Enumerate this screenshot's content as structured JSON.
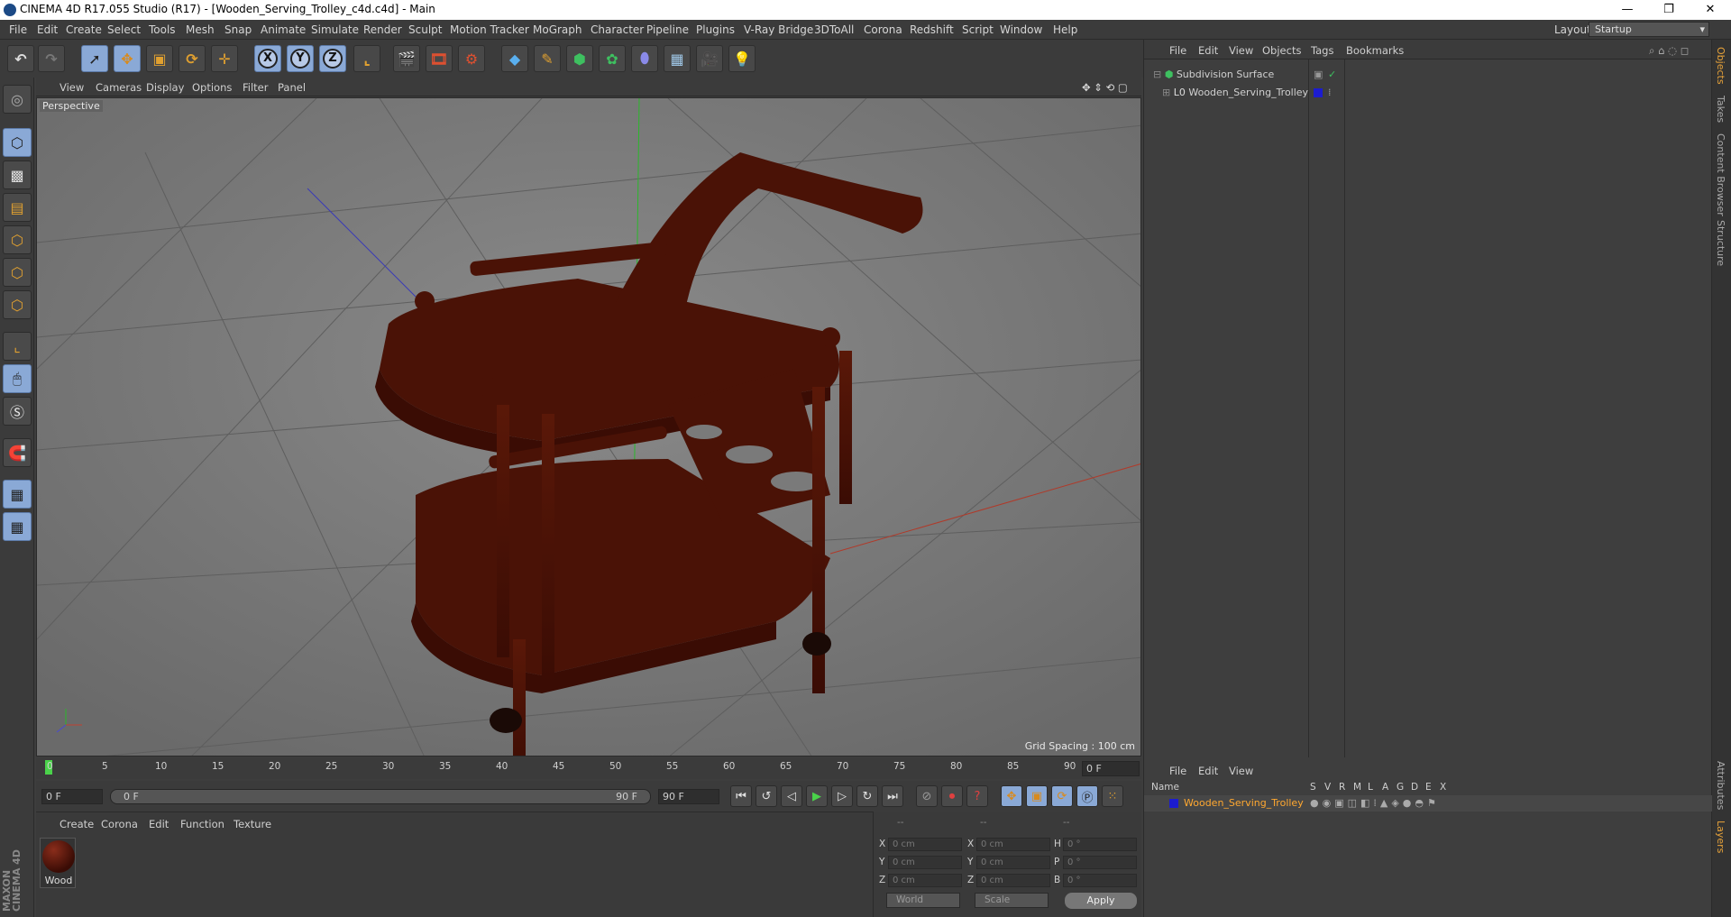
{
  "window": {
    "title": "CINEMA 4D R17.055 Studio (R17) - [Wooden_Serving_Trolley_c4d.c4d] - Main",
    "minimize": "—",
    "restore": "❐",
    "close": "✕"
  },
  "menu": {
    "items": [
      "File",
      "Edit",
      "Create",
      "Select",
      "Tools",
      "Mesh",
      "Snap",
      "Animate",
      "Simulate",
      "Render",
      "Sculpt",
      "Motion Tracker",
      "MoGraph",
      "Character",
      "Pipeline",
      "Plugins",
      "V-Ray Bridge",
      "3DToAll",
      "Corona",
      "Redshift",
      "Script",
      "Window",
      "Help"
    ],
    "layout_label": "Layout:",
    "layout_value": "Startup"
  },
  "toolbar": {
    "axis_x": "X",
    "axis_y": "Y",
    "axis_z": "Z"
  },
  "viewport": {
    "menu": [
      "View",
      "Cameras",
      "Display",
      "Options",
      "Filter",
      "Panel"
    ],
    "camera_label": "Perspective",
    "grid_spacing": "Grid Spacing : 100 cm"
  },
  "objects_panel": {
    "menu": [
      "File",
      "Edit",
      "View",
      "Objects",
      "Tags",
      "Bookmarks"
    ],
    "rows": [
      {
        "name": "Subdivision Surface"
      },
      {
        "name": "Wooden_Serving_Trolley"
      }
    ]
  },
  "side_tabs": [
    "Objects",
    "Takes",
    "Content Browser",
    "Structure"
  ],
  "side_tabs_bottom": [
    "Attributes",
    "Layers"
  ],
  "timeline": {
    "ticks": [
      "0",
      "5",
      "10",
      "15",
      "20",
      "25",
      "30",
      "35",
      "40",
      "45",
      "50",
      "55",
      "60",
      "65",
      "70",
      "75",
      "80",
      "85",
      "90"
    ],
    "current_frame": "0 F"
  },
  "transport": {
    "start_field": "0 F",
    "range_start": "0 F",
    "range_end": "90 F",
    "end_field": "90 F"
  },
  "materials": {
    "menu": [
      "Create",
      "Corona",
      "Edit",
      "Function",
      "Texture"
    ],
    "items": [
      {
        "name": "Wood"
      }
    ]
  },
  "coordinates": {
    "headers": [
      "--",
      "--",
      "--"
    ],
    "rows": [
      {
        "a_lbl": "X",
        "a_val": "0 cm",
        "b_lbl": "X",
        "b_val": "0 cm",
        "c_lbl": "H",
        "c_val": "0 °"
      },
      {
        "a_lbl": "Y",
        "a_val": "0 cm",
        "b_lbl": "Y",
        "b_val": "0 cm",
        "c_lbl": "P",
        "c_val": "0 °"
      },
      {
        "a_lbl": "Z",
        "a_val": "0 cm",
        "b_lbl": "Z",
        "b_val": "0 cm",
        "c_lbl": "B",
        "c_val": "0 °"
      }
    ],
    "mode": "World",
    "transform": "Scale",
    "apply": "Apply"
  },
  "layers_panel": {
    "menu": [
      "File",
      "Edit",
      "View"
    ],
    "columns": [
      "Name",
      "S",
      "V",
      "R",
      "M",
      "L",
      "A",
      "G",
      "D",
      "E",
      "X"
    ],
    "row_name": "Wooden_Serving_Trolley"
  },
  "brand": "MAXON CINEMA 4D",
  "colors": {
    "accent": "#ffa830",
    "layer_blue": "#1c1ccf",
    "active": "#8aa9d6"
  }
}
